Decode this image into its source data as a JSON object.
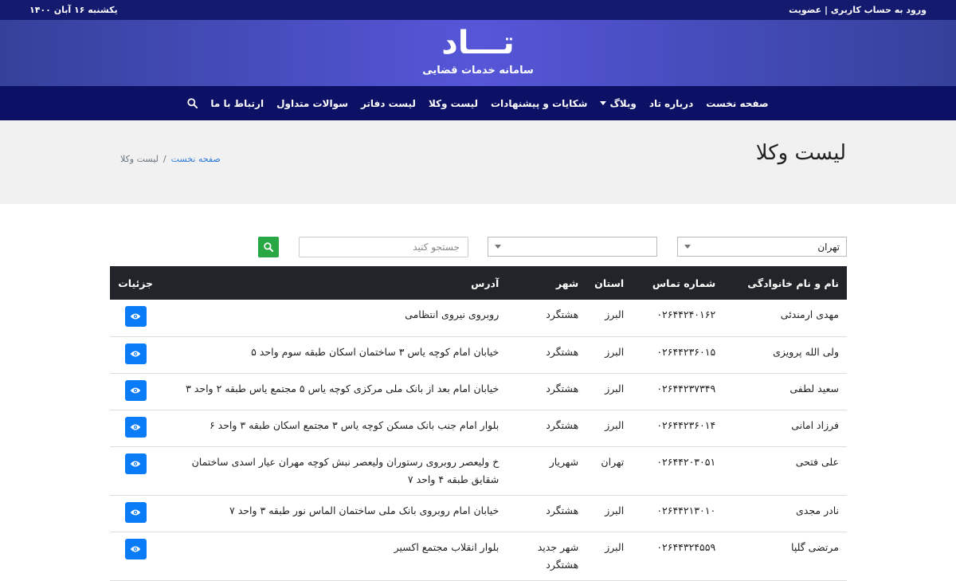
{
  "topbar": {
    "login_label": "ورود به حساب کاربری | عضویت",
    "date": "یکشنبه ۱۶ آبان ۱۴۰۰"
  },
  "hero": {
    "logo": "تـــاد",
    "tagline": "سامانه خدمات قضایی"
  },
  "nav": {
    "items": [
      "صفحه نخست",
      "درباره تاد",
      "وبلاگ",
      "شکایات و پیشنهادات",
      "لیست وکلا",
      "لیست دفاتر",
      "سوالات متداول",
      "ارتباط با ما"
    ]
  },
  "page": {
    "title": "لیست وکلا",
    "breadcrumb_home": "صفحه نخست",
    "breadcrumb_current": "لیست وکلا",
    "breadcrumb_sep": "/"
  },
  "filters": {
    "province": "تهران",
    "city": "",
    "search_placeholder": "جستجو کنید"
  },
  "table": {
    "headers": [
      "نام و نام خانوادگی",
      "شماره تماس",
      "استان",
      "شهر",
      "آدرس",
      "جزئیات"
    ],
    "rows": [
      [
        "مهدی ارمندئی",
        "۰۲۶۴۴۲۴۰۱۶۲",
        "البرز",
        "هشتگرد",
        "روبروی نیروی انتظامی"
      ],
      [
        "ولی الله پرویزی",
        "۰۲۶۴۴۲۳۶۰۱۵",
        "البرز",
        "هشتگرد",
        "خیابان امام کوچه یاس ۳ ساختمان اسکان طبقه سوم واحد ۵"
      ],
      [
        "سعید لطفی",
        "۰۲۶۴۴۲۳۷۳۴۹",
        "البرز",
        "هشتگرد",
        "خیابان امام بعد از بانک ملی مرکزی کوچه یاس ۵ مجتمع یاس طبقه ۲ واحد ۳"
      ],
      [
        "فرزاد امانی",
        "۰۲۶۴۴۲۳۶۰۱۴",
        "البرز",
        "هشتگرد",
        "بلوار امام جنب بانک مسکن کوچه یاس ۳ مجتمع اسکان طبقه ۳ واحد ۶"
      ],
      [
        "علی فتحی",
        "۰۲۶۴۴۲۰۳۰۵۱",
        "تهران",
        "شهریار",
        "خ ولیعصر روبروی رستوران ولیعصر نبش کوچه مهران عیار اسدی ساختمان شقایق طبقه ۴ واحد ۷"
      ],
      [
        "نادر مجدی",
        "۰۲۶۴۴۲۱۳۰۱۰",
        "البرز",
        "هشتگرد",
        "خیابان امام روبروی بانک ملی ساختمان الماس نور طبقه ۳ واحد ۷"
      ],
      [
        "مرتضی گلپا",
        "۰۲۶۴۴۳۲۴۵۵۹",
        "البرز",
        "شهر جدید هشتگرد",
        "بلوار انقلاب مجتمع اکسیر"
      ]
    ]
  },
  "colors": {
    "topbar": "#141a6e",
    "nav": "#0d1165",
    "accent_blue": "#0b7cf8",
    "accent_green": "#28a745"
  }
}
